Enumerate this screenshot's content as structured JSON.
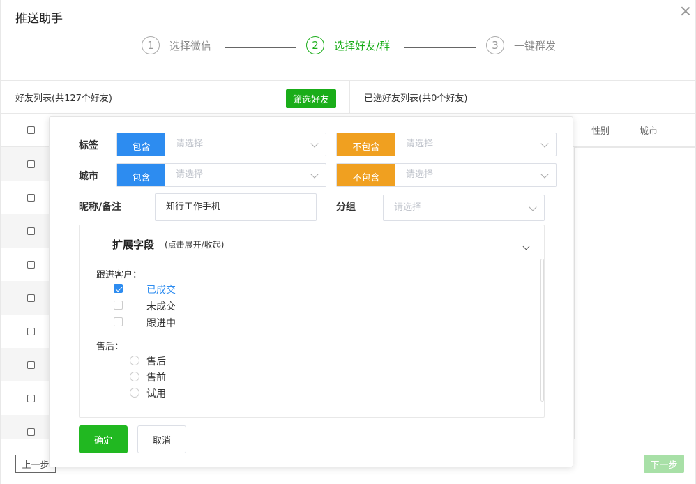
{
  "dialog": {
    "title": "推送助手"
  },
  "steps": [
    {
      "num": "1",
      "label": "选择微信"
    },
    {
      "num": "2",
      "label": "选择好友/群"
    },
    {
      "num": "3",
      "label": "一键群发"
    }
  ],
  "left_panel": {
    "title": "好友列表(共127个好友)",
    "filter_button": "筛选好友"
  },
  "right_panel": {
    "title": "已选好友列表(共0个好友)",
    "columns": {
      "gender": "性别",
      "city": "城市"
    }
  },
  "filter": {
    "tag": {
      "label": "标签",
      "include": "包含",
      "exclude": "不包含",
      "placeholder": "请选择"
    },
    "city": {
      "label": "城市",
      "include": "包含",
      "exclude": "不包含",
      "placeholder": "请选择"
    },
    "nickname": {
      "label": "昵称/备注",
      "value": "知行工作手机"
    },
    "group": {
      "label": "分组",
      "placeholder": "请选择"
    },
    "extended": {
      "title": "扩展字段",
      "subtitle": "(点击展开/收起)",
      "follow_up": {
        "label": "跟进客户：",
        "options": [
          {
            "label": "已成交",
            "checked": true
          },
          {
            "label": "未成交",
            "checked": false
          },
          {
            "label": "跟进中",
            "checked": false
          }
        ]
      },
      "after_sales": {
        "label": "售后：",
        "options": [
          {
            "label": "售后"
          },
          {
            "label": "售前"
          },
          {
            "label": "试用"
          }
        ]
      }
    },
    "confirm": "确定",
    "cancel": "取消"
  },
  "footer": {
    "prev": "上一步",
    "next": "下一步"
  },
  "colors": {
    "primary_green": "#1aad19",
    "blue": "#2d8cf0",
    "orange": "#f0a020"
  }
}
